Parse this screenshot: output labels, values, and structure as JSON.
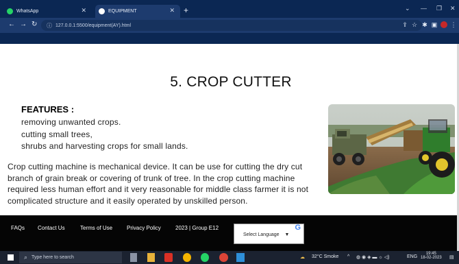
{
  "browser": {
    "tabs": [
      {
        "label": "WhatsApp",
        "active": false,
        "icon": "whatsapp-icon",
        "color": "#25d366"
      },
      {
        "label": "EQUIPMENT",
        "active": true,
        "icon": "chrome-icon",
        "color": "#ffffff"
      }
    ],
    "url": "127.0.0.1:5500/equipment(AY).html"
  },
  "page": {
    "title": "5. CROP CUTTER",
    "features_heading": "FEATURES :",
    "features": [
      "removing unwanted crops.",
      "cutting small trees,",
      "shrubs and harvesting crops for small lands."
    ],
    "description_lines": [
      "Crop cutting machine is mechanical device. It can be use for cutting the dry cut",
      "branch of grain break or covering of trunk of tree. In the crop cutting machine",
      "required less human effort and it very reasonable for middle class farmer it is not",
      "complicated structure and it easily operated by unskilled person."
    ],
    "image_alt": "tractor harvesting crops in field"
  },
  "footer": {
    "links": [
      "FAQs",
      "Contact Us",
      "Terms of Use",
      "Privacy Policy"
    ],
    "copyright": "2023 | Group E12",
    "language_select": "Select Language",
    "language_arrow": "▼",
    "google_mark": "G"
  },
  "taskbar": {
    "search_placeholder": "Type here to search",
    "weather": "32°C  Smoke",
    "language": "ENG",
    "time": "19:45",
    "date": "18-02-2023"
  },
  "colors": {
    "chrome_dark": "#0b2753",
    "chrome_mid": "#1d3b6e",
    "footer_bg": "#050505",
    "taskbar_bg": "#1b2230"
  }
}
